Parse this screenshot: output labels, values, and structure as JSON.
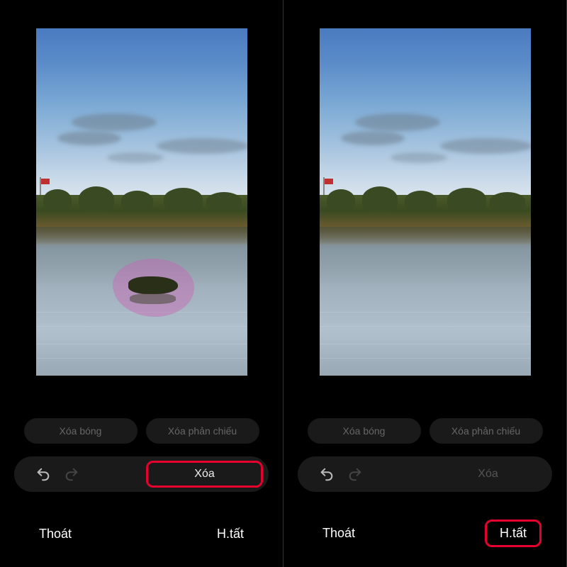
{
  "buttons": {
    "erase_shadow": "Xóa bóng",
    "erase_reflection": "Xóa phản chiếu",
    "erase": "Xóa",
    "exit": "Thoát",
    "done": "H.tất"
  },
  "icons": {
    "undo": "undo-arrow",
    "redo": "redo-arrow"
  },
  "left_panel": {
    "has_selection": true,
    "highlight": "erase"
  },
  "right_panel": {
    "has_selection": false,
    "highlight": "done"
  }
}
